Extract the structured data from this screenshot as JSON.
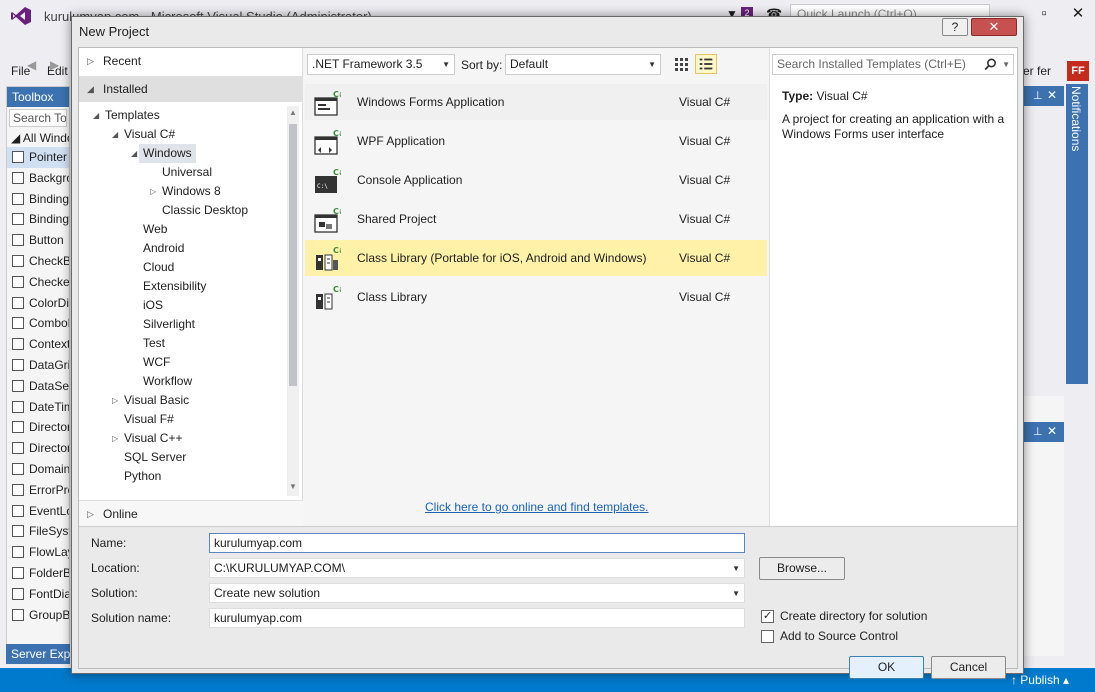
{
  "vs": {
    "title": "kurulumyap.com - Microsoft Visual Studio (Administrator)",
    "quick_launch_placeholder": "Quick Launch (Ctrl+Q)",
    "menu": [
      "File",
      "Edit"
    ],
    "user": "ner fer",
    "avatar": "FF",
    "toolbox": {
      "title": "Toolbox",
      "search_placeholder": "Search Toolbox",
      "group": "All Windows Forms",
      "items": [
        "Pointer",
        "BackgroundWorker",
        "BindingNavigator",
        "BindingSource",
        "Button",
        "CheckBox",
        "CheckedListBox",
        "ColorDialog",
        "ComboBox",
        "ContextMenuStrip",
        "DataGridView",
        "DataSet",
        "DateTimePicker",
        "DirectoryEntry",
        "DirectorySearcher",
        "DomainUpDown",
        "ErrorProvider",
        "EventLog",
        "FileSystemWatcher",
        "FlowLayoutPanel",
        "FolderBrowserDialog",
        "FontDialog",
        "GroupBox"
      ]
    },
    "server_explorer": "Server Explorer",
    "notifications": "Notifications",
    "publish": "Publish"
  },
  "dialog": {
    "title": "New Project",
    "help_label": "?",
    "close_label": "✕",
    "left": {
      "recent": "Recent",
      "installed": "Installed",
      "online": "Online",
      "tree": [
        {
          "label": "Templates",
          "expander": "◢"
        },
        {
          "label": "Visual C#",
          "expander": "◢"
        },
        {
          "label": "Windows",
          "expander": "◢"
        },
        {
          "label": "Universal",
          "expander": ""
        },
        {
          "label": "Windows 8",
          "expander": "▷"
        },
        {
          "label": "Classic Desktop",
          "expander": ""
        },
        {
          "label": "Web",
          "expander": ""
        },
        {
          "label": "Android",
          "expander": ""
        },
        {
          "label": "Cloud",
          "expander": ""
        },
        {
          "label": "Extensibility",
          "expander": ""
        },
        {
          "label": "iOS",
          "expander": ""
        },
        {
          "label": "Silverlight",
          "expander": ""
        },
        {
          "label": "Test",
          "expander": ""
        },
        {
          "label": "WCF",
          "expander": ""
        },
        {
          "label": "Workflow",
          "expander": ""
        },
        {
          "label": "Visual Basic",
          "expander": "▷"
        },
        {
          "label": "Visual F#",
          "expander": ""
        },
        {
          "label": "Visual C++",
          "expander": "▷"
        },
        {
          "label": "SQL Server",
          "expander": ""
        },
        {
          "label": "Python",
          "expander": ""
        }
      ]
    },
    "center": {
      "framework": ".NET Framework 3.5",
      "sort_label": "Sort by:",
      "sort_value": "Default",
      "templates": [
        {
          "name": "Windows Forms Application",
          "lang": "Visual C#",
          "icon": "winforms-icon"
        },
        {
          "name": "WPF Application",
          "lang": "Visual C#",
          "icon": "wpf-icon"
        },
        {
          "name": "Console Application",
          "lang": "Visual C#",
          "icon": "console-icon"
        },
        {
          "name": "Shared Project",
          "lang": "Visual C#",
          "icon": "shared-project-icon"
        },
        {
          "name": "Class Library (Portable for iOS, Android and Windows)",
          "lang": "Visual C#",
          "icon": "class-library-portable-icon"
        },
        {
          "name": "Class Library",
          "lang": "Visual C#",
          "icon": "class-library-icon"
        }
      ],
      "online_link": "Click here to go online and find templates."
    },
    "right": {
      "search_placeholder": "Search Installed Templates (Ctrl+E)",
      "type_label": "Type:",
      "type_value": "Visual C#",
      "description": "A project for creating an application with a Windows Forms user interface"
    },
    "form": {
      "name_label": "Name:",
      "name_value": "kurulumyap.com",
      "location_label": "Location:",
      "location_value": "C:\\KURULUMYAP.COM\\",
      "solution_label": "Solution:",
      "solution_value": "Create new solution",
      "solution_name_label": "Solution name:",
      "solution_name_value": "kurulumyap.com",
      "browse_label": "Browse...",
      "create_dir_label": "Create directory for solution",
      "create_dir_checked": true,
      "source_control_label": "Add to Source Control",
      "source_control_checked": false,
      "ok_label": "OK",
      "cancel_label": "Cancel"
    }
  }
}
